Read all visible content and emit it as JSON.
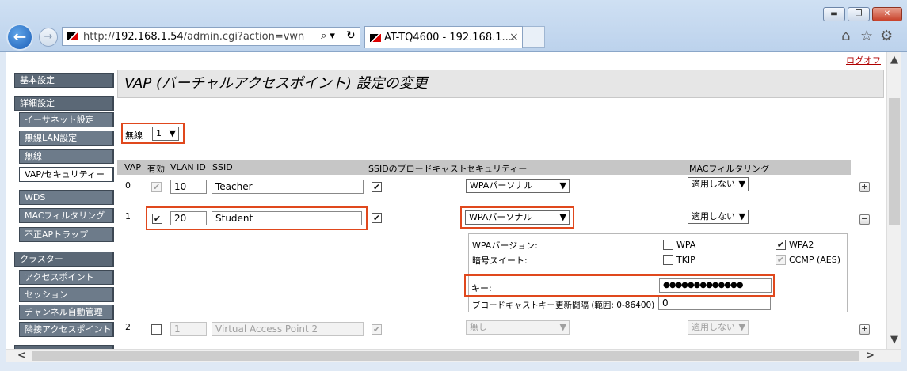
{
  "browser": {
    "url_prefix": "http://",
    "url_host": "192.168.1.54",
    "url_path": "/admin.cgi?action=vwn",
    "search_glyph": "⌕ ▾",
    "refresh_glyph": "↻",
    "tab_title": "AT-TQ4600 - 192.168.1....",
    "tab_close": "×",
    "window_buttons": {
      "minimize": "▬",
      "maximize": "❐",
      "close": "✕"
    },
    "toolbar_icons": {
      "home": "⌂",
      "favorites": "☆",
      "settings": "⚙"
    }
  },
  "header": {
    "logout": "ログオフ",
    "title": "VAP (バーチャルアクセスポイント) 設定の変更"
  },
  "sidebar": {
    "items": [
      {
        "label": "基本設定"
      },
      {
        "label": "詳細設定"
      },
      {
        "label": "イーサネット設定"
      },
      {
        "label": "無線LAN設定"
      },
      {
        "label": "無線"
      },
      {
        "label": "VAP/セキュリティー"
      },
      {
        "label": "WDS"
      },
      {
        "label": "MACフィルタリング"
      },
      {
        "label": "不正APトラップ"
      },
      {
        "label": "クラスター"
      },
      {
        "label": "アクセスポイント"
      },
      {
        "label": "セッション"
      },
      {
        "label": "チャンネル自動管理"
      },
      {
        "label": "隣接アクセスポイント"
      }
    ]
  },
  "radio": {
    "label": "無線",
    "value": "1"
  },
  "table": {
    "headers": {
      "vap": "VAP",
      "enabled": "有効",
      "vlan": "VLAN ID",
      "ssid": "SSID",
      "broadcast": "SSIDのブロードキャスト",
      "security": "セキュリティー",
      "mac": "MACフィルタリング"
    },
    "rows": [
      {
        "vap": "0",
        "enabled": "✔",
        "vlan": "10",
        "ssid": "Teacher",
        "broadcast": "✔",
        "security": "WPAパーソナル",
        "mac": "適用しない",
        "toggle": "+"
      },
      {
        "vap": "1",
        "enabled": "✔",
        "vlan": "20",
        "ssid": "Student",
        "broadcast": "✔",
        "security": "WPAパーソナル",
        "mac": "適用しない",
        "toggle": "−"
      },
      {
        "vap": "2",
        "enabled": "",
        "vlan": "1",
        "ssid": "Virtual Access Point 2",
        "broadcast": "✔",
        "security": "無し",
        "mac": "適用しない",
        "toggle": "+"
      }
    ]
  },
  "wpa": {
    "version_label": "WPAバージョン:",
    "cipher_label": "暗号スイート:",
    "wpa": {
      "label": "WPA",
      "check": ""
    },
    "wpa2": {
      "label": "WPA2",
      "check": "✔"
    },
    "tkip": {
      "label": "TKIP",
      "check": ""
    },
    "ccmp": {
      "label": "CCMP (AES)",
      "check": "✔"
    },
    "key_label": "キー:",
    "key_value": "●●●●●●●●●●●●●",
    "rekey_label": "ブロードキャストキー更新間隔 (範囲: 0-86400)",
    "rekey_value": "0"
  },
  "colors": {
    "highlight": "#e0481d",
    "sidebar": "#6d7b8a",
    "logout": "#b00000"
  }
}
